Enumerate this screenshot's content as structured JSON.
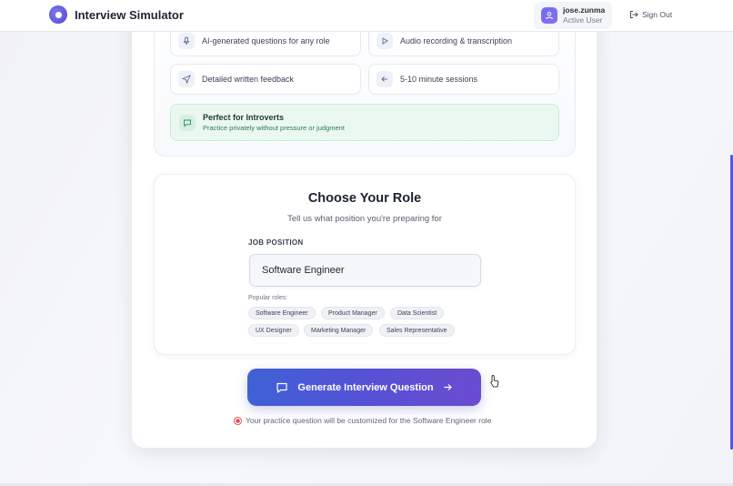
{
  "header": {
    "app_title": "Interview Simulator",
    "user": {
      "name": "jose.zunma",
      "status": "Active User"
    },
    "signout_label": "Sign Out"
  },
  "features": [
    {
      "label": "AI-generated questions for any role",
      "icon": "mic-icon"
    },
    {
      "label": "Audio recording & transcription",
      "icon": "play-icon"
    },
    {
      "label": "Detailed written feedback",
      "icon": "send-icon"
    },
    {
      "label": "5-10 minute sessions",
      "icon": "back-arrow-icon"
    }
  ],
  "introvert_box": {
    "title": "Perfect for Introverts",
    "subtitle": "Practice privately without pressure or judgment"
  },
  "role_section": {
    "heading": "Choose Your Role",
    "subheading": "Tell us what position you're preparing for",
    "job_label": "JOB POSITION",
    "job_value": "Software Engineer",
    "popular_label": "Popular roles:",
    "popular_roles": [
      "Software Engineer",
      "Product Manager",
      "Data Scientist",
      "UX Designer",
      "Marketing Manager",
      "Sales Representative"
    ]
  },
  "generate_button": {
    "label": "Generate Interview Question"
  },
  "footer_note": "Your practice question will be customized for the Software Engineer role",
  "colors": {
    "accent": "#5551d6",
    "button_start": "#3f62d6",
    "button_end": "#6a4cd0",
    "success_bg": "#ebf8f1"
  }
}
